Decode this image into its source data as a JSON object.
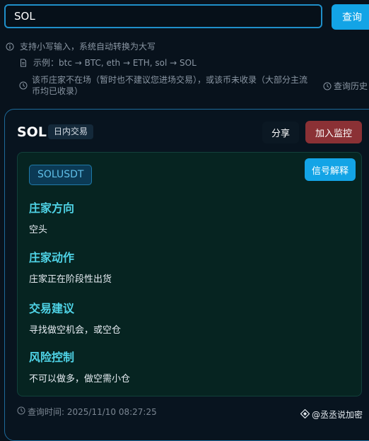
{
  "search": {
    "value": "SOL",
    "button_label": "查询"
  },
  "hints": {
    "case_note": "支持小写输入，系统自动转换为大写",
    "example": "示例：btc → BTC, eth → ETH, sol → SOL",
    "warning_line1": "该币庄家不在场（暂时也不建议您进场交易），或该币未收录（大部分主流",
    "warning_line2": "币均已收录）",
    "history_link": "查询历史"
  },
  "card": {
    "coin": "SOL",
    "badge": "日内交易",
    "share_label": "分享",
    "monitor_label": "加入监控",
    "symbol": "SOLUSDT",
    "explain_label": "信号解释",
    "sections": [
      {
        "heading": "庄家方向",
        "text": "空头"
      },
      {
        "heading": "庄家动作",
        "text": "庄家正在阶段性出货"
      },
      {
        "heading": "交易建议",
        "text": "寻找做空机会，或空仓"
      },
      {
        "heading": "风险控制",
        "text": "不可以做多，做空需小仓"
      }
    ],
    "query_time": "查询时间: 2025/11/10 08:27:25",
    "watermark": "@丞丞说加密"
  },
  "colors": {
    "accent": "#13a4e6",
    "monitor": "#8b3135",
    "section_heading": "#4fd3e6",
    "panel_bg": "#062421"
  },
  "icons": [
    "info-circle-icon",
    "document-icon",
    "clock-icon",
    "history-icon",
    "binance-diamond-icon"
  ]
}
